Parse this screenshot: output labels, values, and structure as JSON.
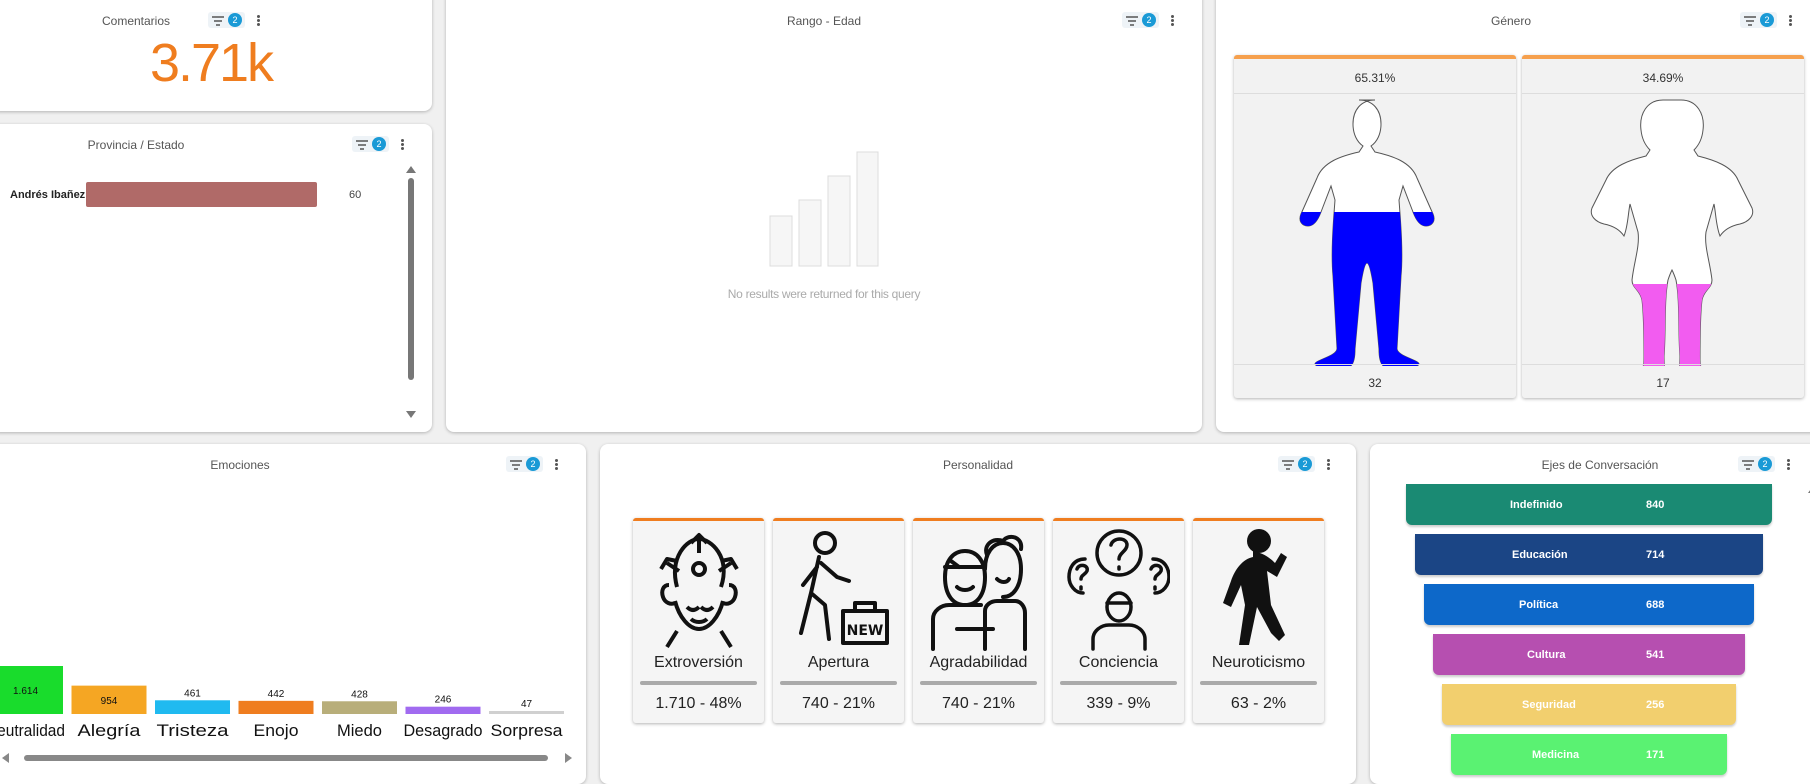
{
  "colors": {
    "accent": "#ef7d1f",
    "badge": "#1a9ad6",
    "male": "#0000ff",
    "female": "#f25cf0"
  },
  "comentarios": {
    "title": "Comentarios",
    "value": "3.71k",
    "filter_count": "2"
  },
  "provincia": {
    "title": "Provincia / Estado",
    "filter_count": "2",
    "rows": [
      {
        "label": "Andrés Ibañez",
        "value": "60"
      }
    ]
  },
  "rango": {
    "title": "Rango - Edad",
    "filter_count": "2",
    "empty_message": "No results were returned for this query"
  },
  "genero": {
    "title": "Género",
    "filter_count": "2",
    "items": [
      {
        "pct": "65.31%",
        "count": "32",
        "icon": "male-figure-icon",
        "fill_fraction": 0.55
      },
      {
        "pct": "34.69%",
        "count": "17",
        "icon": "female-figure-icon",
        "fill_fraction": 0.3
      }
    ]
  },
  "emociones": {
    "title": "Emociones",
    "filter_count": "2"
  },
  "chart_data": {
    "type": "bar",
    "categories": [
      "Neutralidad",
      "Alegría",
      "Tristeza",
      "Enojo",
      "Miedo",
      "Desagrado",
      "Sorpresa"
    ],
    "values": [
      1614,
      954,
      461,
      442,
      428,
      246,
      47
    ],
    "labels": [
      "1.614",
      "954",
      "461",
      "442",
      "428",
      "246",
      "47"
    ],
    "colors": [
      "#19dc2c",
      "#f5a623",
      "#20baf0",
      "#ef7d1f",
      "#b8ae7a",
      "#a16bf0",
      "#d0d0d0"
    ]
  },
  "personalidad": {
    "title": "Personalidad",
    "filter_count": "2",
    "items": [
      {
        "name": "Extroversión",
        "value": "1.710 - 48%",
        "icon": "head-arrows-icon"
      },
      {
        "name": "Apertura",
        "value": "740 - 21%",
        "icon": "walker-new-icon"
      },
      {
        "name": "Agradabilidad",
        "value": "740 - 21%",
        "icon": "friends-icon"
      },
      {
        "name": "Conciencia",
        "value": "339 - 9%",
        "icon": "thinking-person-icon"
      },
      {
        "name": "Neuroticismo",
        "value": "63 - 2%",
        "icon": "anxious-person-icon"
      }
    ]
  },
  "ejes": {
    "title": "Ejes de Conversación",
    "filter_count": "2",
    "items": [
      {
        "label": "Indefinido",
        "value": "840",
        "color": "#1a8a73"
      },
      {
        "label": "Educación",
        "value": "714",
        "color": "#1b4585"
      },
      {
        "label": "Política",
        "value": "688",
        "color": "#0d68c9"
      },
      {
        "label": "Cultura",
        "value": "541",
        "color": "#b64fb0"
      },
      {
        "label": "Seguridad",
        "value": "256",
        "color": "#f2cf6e"
      },
      {
        "label": "Medicina",
        "value": "171",
        "color": "#5af272"
      }
    ]
  }
}
